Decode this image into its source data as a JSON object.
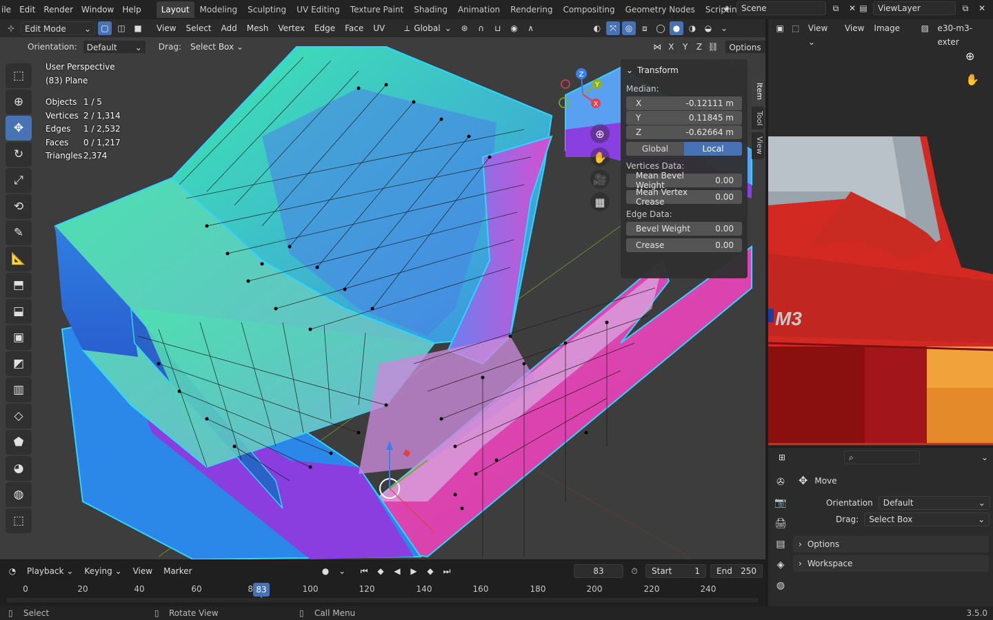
{
  "topbar": {
    "menus": [
      "ile",
      "Edit",
      "Render",
      "Window",
      "Help"
    ],
    "workspaces": [
      "Layout",
      "Modeling",
      "Sculpting",
      "UV Editing",
      "Texture Paint",
      "Shading",
      "Animation",
      "Rendering",
      "Compositing",
      "Geometry Nodes",
      "Scripting"
    ],
    "active_workspace": "Layout",
    "add_tab": "+",
    "scene": "Scene",
    "view_layer": "ViewLayer"
  },
  "viewport_header": {
    "mode": "Edit Mode",
    "menus": [
      "View",
      "Select",
      "Add",
      "Mesh",
      "Vertex",
      "Edge",
      "Face",
      "UV"
    ],
    "transform_orientation": "Global"
  },
  "tool_header": {
    "orientation_label": "Orientation:",
    "orientation_value": "Default",
    "drag_label": "Drag:",
    "drag_value": "Select Box",
    "axes": [
      "X",
      "Y",
      "Z"
    ],
    "options": "Options"
  },
  "overlay": {
    "view_name": "User Perspective",
    "object_name": "(83) Plane",
    "stats": [
      {
        "label": "Objects",
        "value": "1 / 5"
      },
      {
        "label": "Vertices",
        "value": "2 / 1,314"
      },
      {
        "label": "Edges",
        "value": "1 / 2,532"
      },
      {
        "label": "Faces",
        "value": "0 / 1,217"
      },
      {
        "label": "Triangles",
        "value": "2,374"
      }
    ]
  },
  "npanel": {
    "title": "Transform",
    "median_label": "Median:",
    "x": {
      "label": "X",
      "value": "-0.12111 m"
    },
    "y": {
      "label": "Y",
      "value": "0.11845 m"
    },
    "z": {
      "label": "Z",
      "value": "-0.62664 m"
    },
    "global": "Global",
    "local": "Local",
    "active_space": "Local",
    "vertices_label": "Vertices Data:",
    "mean_bevel": {
      "label": "Mean Bevel Weight",
      "value": "0.00"
    },
    "mean_crease": {
      "label": "Mean Vertex Crease",
      "value": "0.00"
    },
    "edge_label": "Edge Data:",
    "bevel_weight": {
      "label": "Bevel Weight",
      "value": "0.00"
    },
    "crease": {
      "label": "Crease",
      "value": "0.00"
    },
    "tabs": [
      "Item",
      "Tool",
      "View"
    ],
    "active_tab": "Item"
  },
  "gizmo": {
    "x": "X",
    "y": "Y",
    "z": "Z"
  },
  "timeline": {
    "menus": [
      "Playback",
      "Keying",
      "View",
      "Marker"
    ],
    "current_frame": "83",
    "start_label": "Start",
    "start": "1",
    "end_label": "End",
    "end": "250",
    "ticks": [
      "0",
      "20",
      "40",
      "60",
      "80",
      "100",
      "120",
      "140",
      "160",
      "180",
      "200",
      "220",
      "240"
    ],
    "playhead_label": "83"
  },
  "status": {
    "select": "Select",
    "rotate": "Rotate View",
    "call_menu": "Call Menu",
    "version": "3.5.0"
  },
  "image_editor": {
    "view": "View",
    "view2": "View",
    "image": "Image",
    "image_name": "e30-m3-exter",
    "badge_text": "M3"
  },
  "properties": {
    "tool_name": "Move",
    "orientation_label": "Orientation",
    "orientation_value": "Default",
    "drag_label": "Drag:",
    "drag_value": "Select Box",
    "sections": [
      "Options",
      "Workspace"
    ]
  },
  "colors": {
    "accent": "#4772b3",
    "mesh_teal": "#3fd9b0",
    "mesh_magenta": "#e04ab0",
    "mesh_purple": "#8a3fe0",
    "car_red": "#d42a24"
  }
}
